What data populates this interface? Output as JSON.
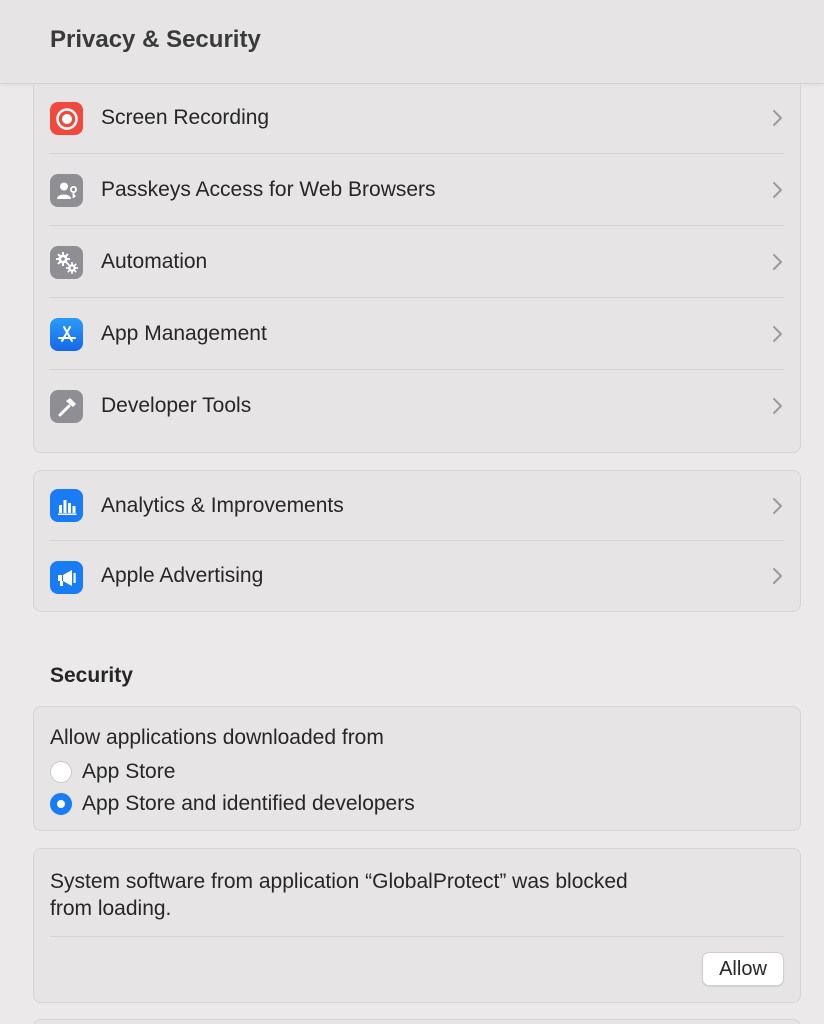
{
  "window": {
    "title": "Privacy & Security"
  },
  "privacy_items": [
    {
      "label": "Screen Recording",
      "icon": "screen-recording-icon",
      "color": "#f04a3f"
    },
    {
      "label": "Passkeys Access for Web Browsers",
      "icon": "passkeys-icon",
      "color": "#8e8e93"
    },
    {
      "label": "Automation",
      "icon": "gears-icon",
      "color": "#8e8e93"
    },
    {
      "label": "App Management",
      "icon": "app-store-icon",
      "color": "#1a7cf5"
    },
    {
      "label": "Developer Tools",
      "icon": "hammer-icon",
      "color": "#8e8e93"
    }
  ],
  "analytics_items": [
    {
      "label": "Analytics & Improvements",
      "icon": "bar-chart-icon",
      "color": "#1a7cf5"
    },
    {
      "label": "Apple Advertising",
      "icon": "megaphone-icon",
      "color": "#1a7cf5"
    }
  ],
  "security": {
    "heading": "Security",
    "allow_label": "Allow applications downloaded from",
    "options": [
      {
        "label": "App Store",
        "selected": false
      },
      {
        "label": "App Store and identified developers",
        "selected": true
      }
    ],
    "blocked_line1": "System software from application “GlobalProtect” was blocked",
    "blocked_line2": "from loading.",
    "allow_button": "Allow"
  },
  "colors": {
    "accent": "#1a7cf5",
    "background": "#ebe9ea"
  }
}
